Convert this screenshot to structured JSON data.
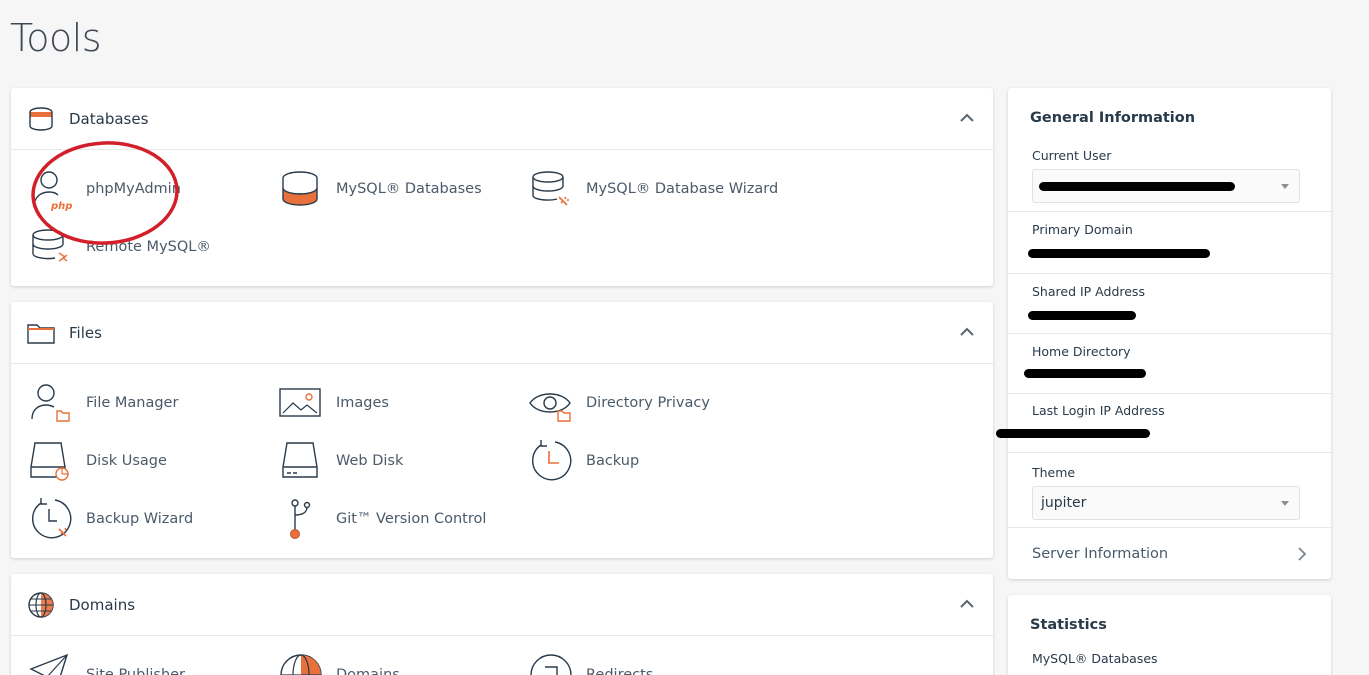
{
  "page": {
    "title": "Tools"
  },
  "colors": {
    "accent": "#e8703b",
    "dark": "#293a4a",
    "annotation": "#d21f2a"
  },
  "panels": {
    "databases": {
      "title": "Databases",
      "icon": "database-icon",
      "tools": [
        {
          "label": "phpMyAdmin",
          "icon": "phpmyadmin-icon"
        },
        {
          "label": "MySQL® Databases",
          "icon": "mysql-databases-icon"
        },
        {
          "label": "MySQL® Database Wizard",
          "icon": "mysql-wizard-icon"
        },
        {
          "label": "Remote MySQL®",
          "icon": "remote-mysql-icon"
        }
      ]
    },
    "files": {
      "title": "Files",
      "icon": "folder-icon",
      "tools": [
        {
          "label": "File Manager",
          "icon": "file-manager-icon"
        },
        {
          "label": "Images",
          "icon": "images-icon"
        },
        {
          "label": "Directory Privacy",
          "icon": "directory-privacy-icon"
        },
        {
          "label": "Disk Usage",
          "icon": "disk-usage-icon"
        },
        {
          "label": "Web Disk",
          "icon": "web-disk-icon"
        },
        {
          "label": "Backup",
          "icon": "backup-icon"
        },
        {
          "label": "Backup Wizard",
          "icon": "backup-wizard-icon"
        },
        {
          "label": "Git™ Version Control",
          "icon": "git-icon"
        }
      ]
    },
    "domains": {
      "title": "Domains",
      "icon": "globe-icon",
      "tools": [
        {
          "label": "Site Publisher",
          "icon": "site-publisher-icon"
        },
        {
          "label": "Domains",
          "icon": "domains-icon"
        },
        {
          "label": "Redirects",
          "icon": "redirects-icon"
        }
      ]
    }
  },
  "general_info": {
    "title": "General Information",
    "current_user_label": "Current User",
    "primary_domain_label": "Primary Domain",
    "shared_ip_label": "Shared IP Address",
    "home_directory_label": "Home Directory",
    "last_login_label": "Last Login IP Address",
    "theme_label": "Theme",
    "theme_value": "jupiter",
    "server_info_label": "Server Information"
  },
  "statistics": {
    "title": "Statistics",
    "mysql_label": "MySQL® Databases"
  }
}
